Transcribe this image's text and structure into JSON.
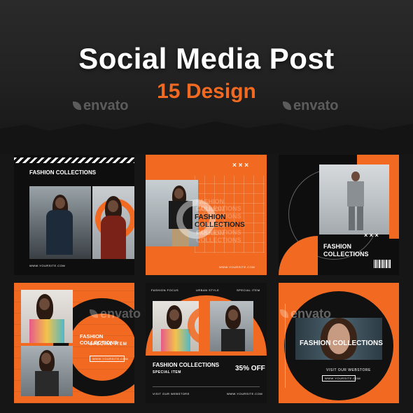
{
  "header": {
    "title": "Social Media Post",
    "subtitle": "15 Design",
    "watermark": "envato"
  },
  "cards": {
    "c1": {
      "heading": "FASHION COLLECTIONS",
      "footer": "WWW.YOURSITE.COM"
    },
    "c2": {
      "heading": "FASHION COLLECTIONS",
      "marks": "× × ×",
      "footer": "WWW.YOURSITE.COM"
    },
    "c3": {
      "heading_line1": "FASHION",
      "heading_line2": "COLLECTIONS",
      "marks": "× × ×"
    },
    "c4": {
      "heading": "FASHION COLLECTIONS",
      "subheading": "SPECIAL ITEM",
      "footer": "WWW.YOURSITE.COM"
    },
    "c5": {
      "top_left": "FASHION FOCUS",
      "top_mid": "URBAN STYLE",
      "top_right": "SPECIAL ITEM",
      "heading": "FASHION COLLECTIONS",
      "subheading": "SPECIAL ITEM",
      "offer": "35% OFF",
      "footer_left": "VISIT OUR WEBSTORE",
      "footer_right": "WWW.YOURSITE.COM"
    },
    "c6": {
      "heading": "FASHION COLLECTIONS",
      "subheading": "VISIT OUR WEBSTORE",
      "footer": "WWW.YOURSITE.COM"
    }
  },
  "colors": {
    "accent": "#f26a21",
    "dark": "#111111",
    "white": "#ffffff"
  }
}
